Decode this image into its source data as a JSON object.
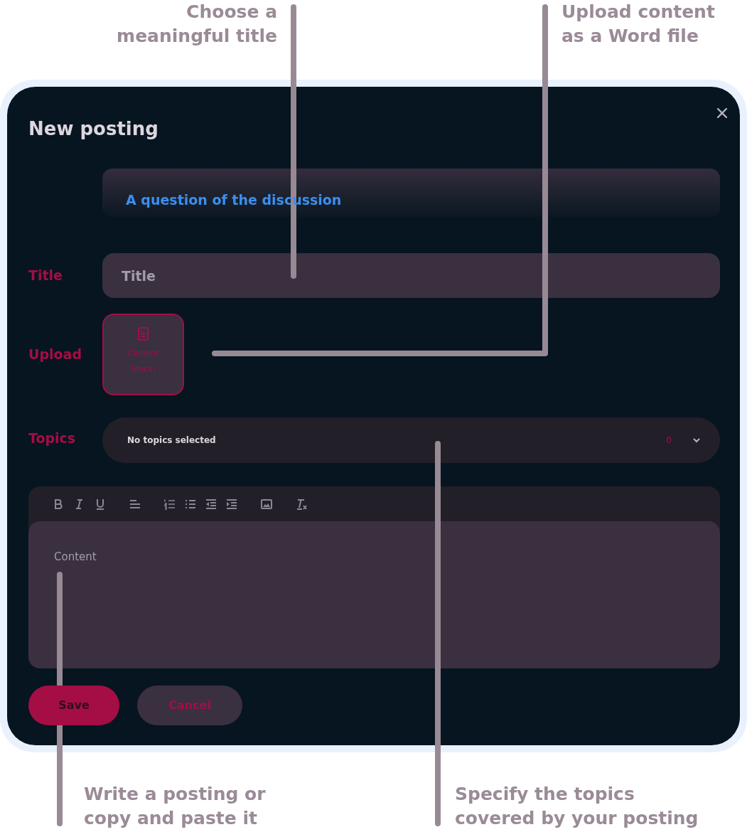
{
  "callouts_top": [
    {
      "lines": [
        "Choose a",
        "meaningful title"
      ]
    },
    {
      "lines": [
        "Upload content",
        "as a Word file"
      ]
    }
  ],
  "dialog": {
    "title": "New posting",
    "question": "A question of the discussion",
    "title_field": {
      "label": "Title",
      "placeholder": "Title"
    },
    "upload": {
      "label": "Upload",
      "tile_text": "Content (docx)"
    },
    "topics": {
      "label": "Topics",
      "value": "No topics selected",
      "count": "0"
    },
    "editor": {
      "toolbar": [
        {
          "items": [
            {
              "kind": "bold"
            },
            {
              "kind": "italic"
            },
            {
              "kind": "underline"
            }
          ]
        },
        {
          "items": [
            {
              "kind": "align"
            }
          ]
        },
        {
          "items": [
            {
              "kind": "ordered-list"
            },
            {
              "kind": "bullet-list"
            },
            {
              "kind": "outdent"
            },
            {
              "kind": "indent"
            }
          ]
        },
        {
          "items": [
            {
              "kind": "image"
            }
          ]
        },
        {
          "items": [
            {
              "kind": "clear-format"
            }
          ]
        }
      ],
      "placeholder": "Content"
    },
    "buttons": [
      {
        "kind": "primary",
        "label": "Save"
      },
      {
        "kind": "secondary",
        "label": "Cancel"
      }
    ]
  },
  "callouts_bottom": [
    {
      "lines": [
        "Write a posting or",
        "copy and paste it"
      ]
    },
    {
      "lines": [
        "Specify the topics",
        "covered by your posting"
      ]
    }
  ]
}
